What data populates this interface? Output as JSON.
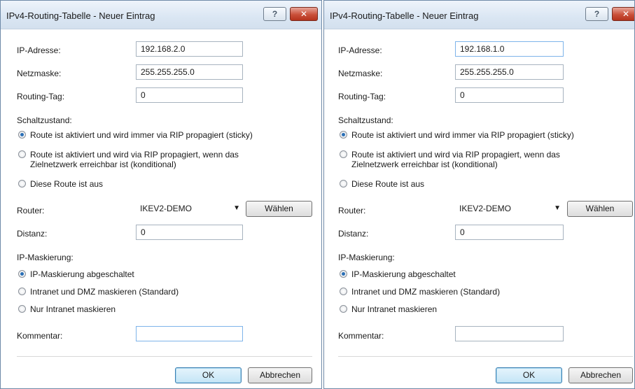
{
  "dialogs": [
    {
      "title": "IPv4-Routing-Tabelle - Neuer Eintrag",
      "help_label": "?",
      "close_label": "✕",
      "ip_label": "IP-Adresse:",
      "ip_value": "192.168.2.0",
      "netmask_label": "Netzmaske:",
      "netmask_value": "255.255.255.0",
      "routing_tag_label": "Routing-Tag:",
      "routing_tag_value": "0",
      "schaltzustand_label": "Schaltzustand:",
      "state_options": [
        "Route ist aktiviert und wird immer via RIP propagiert (sticky)",
        "Route ist aktiviert und wird via RIP propagiert, wenn das",
        "Zielnetzwerk erreichbar ist (konditional)",
        "Diese Route ist aus"
      ],
      "router_label": "Router:",
      "router_value": "IKEV2-DEMO",
      "waehlen_label": "Wählen",
      "distanz_label": "Distanz:",
      "distanz_value": "0",
      "masking_label": "IP-Maskierung:",
      "masking_options": [
        "IP-Maskierung abgeschaltet",
        "Intranet und DMZ maskieren (Standard)",
        "Nur Intranet maskieren"
      ],
      "kommentar_label": "Kommentar:",
      "kommentar_value": "",
      "ok_label": "OK",
      "cancel_label": "Abbrechen"
    },
    {
      "title": "IPv4-Routing-Tabelle - Neuer Eintrag",
      "help_label": "?",
      "close_label": "✕",
      "ip_label": "IP-Adresse:",
      "ip_value": "192.168.1.0",
      "netmask_label": "Netzmaske:",
      "netmask_value": "255.255.255.0",
      "routing_tag_label": "Routing-Tag:",
      "routing_tag_value": "0",
      "schaltzustand_label": "Schaltzustand:",
      "state_options": [
        "Route ist aktiviert und wird immer via RIP propagiert (sticky)",
        "Route ist aktiviert und wird via RIP propagiert, wenn das",
        "Zielnetzwerk erreichbar ist (konditional)",
        "Diese Route ist aus"
      ],
      "router_label": "Router:",
      "router_value": "IKEV2-DEMO",
      "waehlen_label": "Wählen",
      "distanz_label": "Distanz:",
      "distanz_value": "0",
      "masking_label": "IP-Maskierung:",
      "masking_options": [
        "IP-Maskierung abgeschaltet",
        "Intranet und DMZ maskieren (Standard)",
        "Nur Intranet maskieren"
      ],
      "kommentar_label": "Kommentar:",
      "kommentar_value": "",
      "ok_label": "OK",
      "cancel_label": "Abbrechen"
    }
  ]
}
